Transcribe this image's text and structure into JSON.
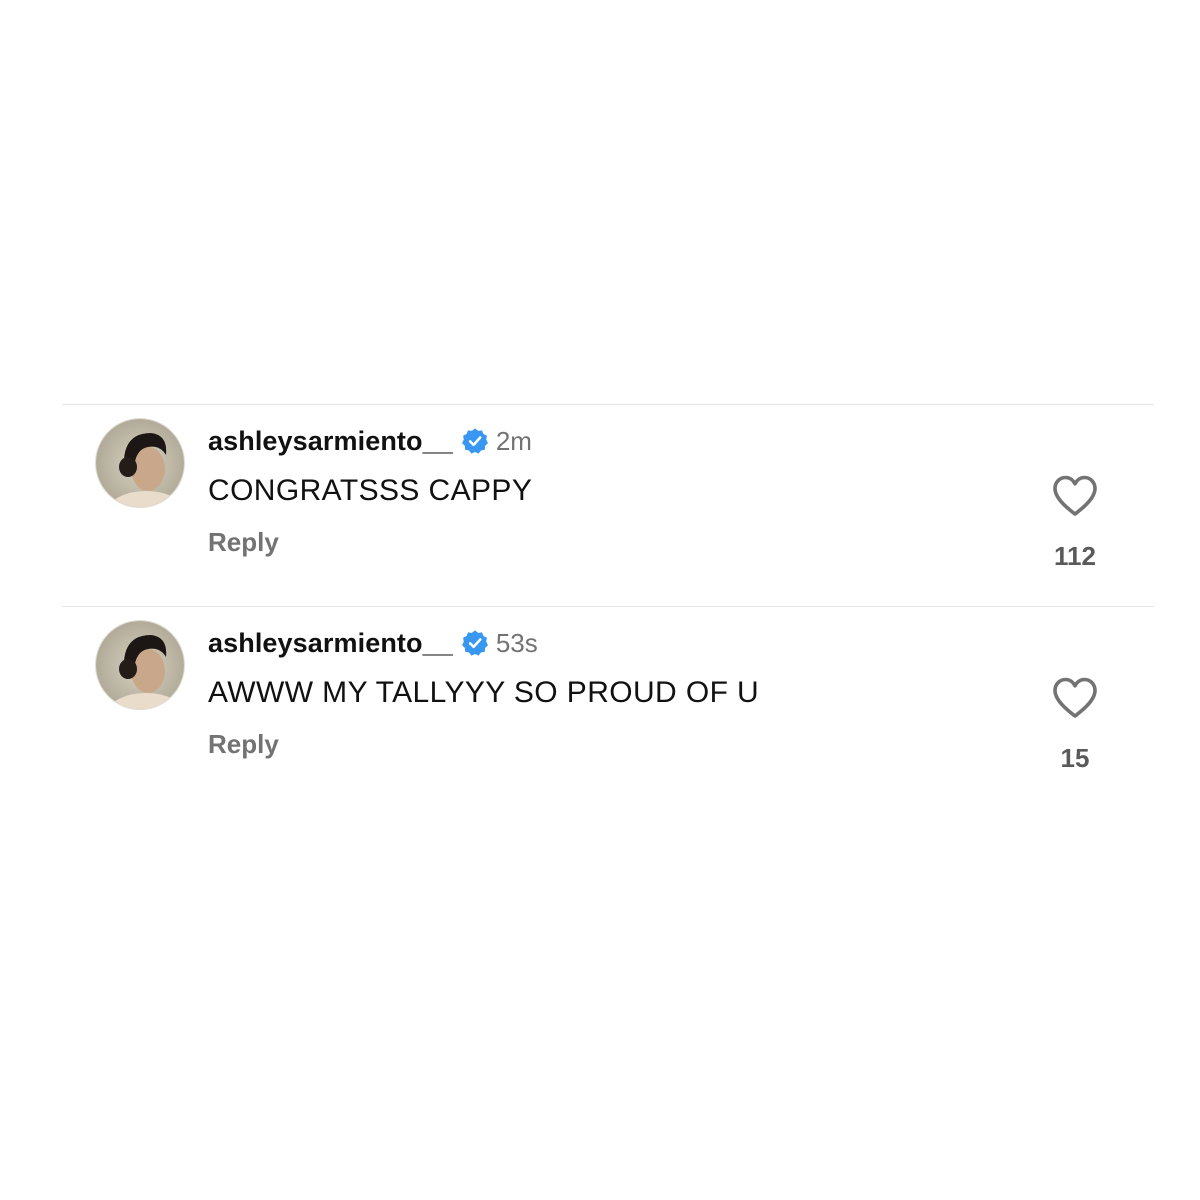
{
  "comments": [
    {
      "username": "ashleysarmiento__",
      "verified_icon": "verified-badge-icon",
      "timestamp": "2m",
      "text": "CONGRATSSS CAPPY",
      "reply_label": "Reply",
      "like_icon": "heart-outline-icon",
      "like_count": "112"
    },
    {
      "username": "ashleysarmiento__",
      "verified_icon": "verified-badge-icon",
      "timestamp": "53s",
      "text": "AWWW MY TALLYYY SO PROUD OF U",
      "reply_label": "Reply",
      "like_icon": "heart-outline-icon",
      "like_count": "15"
    }
  ],
  "colors": {
    "background": "#ffffff",
    "text_primary": "#111111",
    "text_secondary": "#737373",
    "verified_blue": "#3897f0",
    "divider": "#e6e6e6"
  }
}
